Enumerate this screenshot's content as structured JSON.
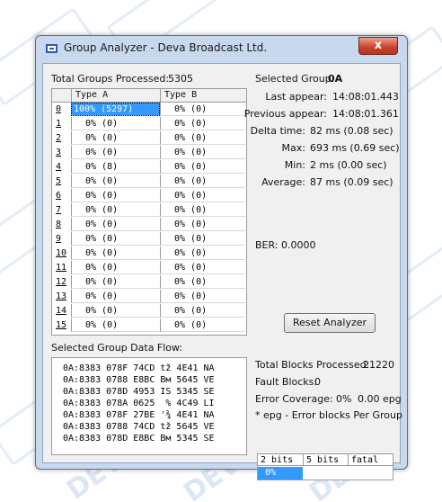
{
  "window": {
    "title": "Group Analyzer - Deva Broadcast Ltd.",
    "close_label": "x"
  },
  "watermark": {
    "text": "DEVA"
  },
  "summary": {
    "total_groups_label": "Total Groups Processed:",
    "total_groups_value": "5305"
  },
  "group_table": {
    "columns": [
      "Type A",
      "Type B"
    ],
    "rows": [
      {
        "idx": "0",
        "a": "100% (5297)",
        "b": "0% (0)"
      },
      {
        "idx": "1",
        "a": "0% (0)",
        "b": "0% (0)"
      },
      {
        "idx": "2",
        "a": "0% (0)",
        "b": "0% (0)"
      },
      {
        "idx": "3",
        "a": "0% (0)",
        "b": "0% (0)"
      },
      {
        "idx": "4",
        "a": "0% (8)",
        "b": "0% (0)"
      },
      {
        "idx": "5",
        "a": "0% (0)",
        "b": "0% (0)"
      },
      {
        "idx": "6",
        "a": "0% (0)",
        "b": "0% (0)"
      },
      {
        "idx": "7",
        "a": "0% (0)",
        "b": "0% (0)"
      },
      {
        "idx": "8",
        "a": "0% (0)",
        "b": "0% (0)"
      },
      {
        "idx": "9",
        "a": "0% (0)",
        "b": "0% (0)"
      },
      {
        "idx": "10",
        "a": "0% (0)",
        "b": "0% (0)"
      },
      {
        "idx": "11",
        "a": "0% (0)",
        "b": "0% (0)"
      },
      {
        "idx": "12",
        "a": "0% (0)",
        "b": "0% (0)"
      },
      {
        "idx": "13",
        "a": "0% (0)",
        "b": "0% (0)"
      },
      {
        "idx": "14",
        "a": "0% (0)",
        "b": "0% (0)"
      },
      {
        "idx": "15",
        "a": "0% (0)",
        "b": "0% (0)"
      }
    ]
  },
  "selected": {
    "group_label": "Selected Group:",
    "group_value": "0A",
    "last_appear_label": "Last appear:",
    "last_appear_value": "14:08:01.443",
    "prev_appear_label": "Previous appear:",
    "prev_appear_value": "14:08:01.361",
    "delta_label": "Delta time:",
    "delta_value": "82 ms (0.08 sec)",
    "max_label": "Max:",
    "max_value": "693 ms (0.69 sec)",
    "min_label": "Min:",
    "min_value": "2 ms (0.00 sec)",
    "avg_label": "Average:",
    "avg_value": "87 ms (0.09 sec)"
  },
  "ber": {
    "text": "BER: 0.0000"
  },
  "reset_button": {
    "label": "Reset Analyzer"
  },
  "data_flow": {
    "label": "Selected Group Data Flow:",
    "lines": [
      "0A:8383 078F 74CD tž 4E41 NA",
      "0A:8383 0788 E8BC Bм 5645 VE",
      "0A:8383 078D 4953 IS 5345 SE",
      "0A:8383 078A 0625  % 4C49 LI",
      "0A:8383 078F 27BE '¾ 4E41 NA",
      "0A:8383 0788 74CD tž 5645 VE",
      "0A:8383 078D E8BC Bм 5345 SE"
    ]
  },
  "blocks": {
    "total_label": "Total Blocks Processed:",
    "total_value": "21220",
    "fault_label": "Fault Blocks:",
    "fault_value": "0",
    "coverage_label": "Error Coverage:",
    "coverage_value": "0%",
    "coverage_epg": "0.00 epg",
    "note": "* epg - Error blocks Per Group"
  },
  "error_grid": {
    "columns": [
      "2 bits",
      "5 bits",
      "fatal"
    ],
    "values": [
      "0%",
      "",
      ""
    ]
  },
  "colors": {
    "selection": "#3399ff",
    "window_frame": "#c8d9ee",
    "close": "#c8412b"
  }
}
